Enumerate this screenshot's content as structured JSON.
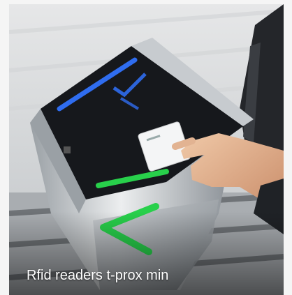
{
  "card": {
    "caption": "Rfid readers t-prox min"
  },
  "icons": {
    "photo": "rfid-turnstile-photo"
  },
  "colors": {
    "reader_light": "#2f6df0",
    "indicator": "#28d04b"
  }
}
